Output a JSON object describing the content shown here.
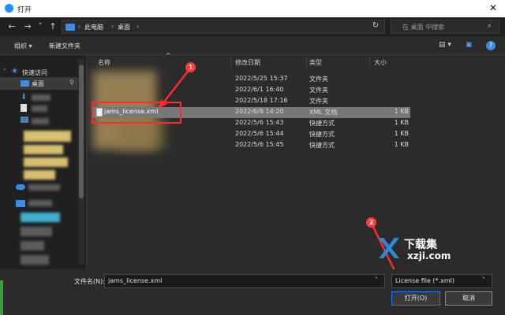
{
  "titlebar": {
    "title": "打开",
    "close": "✕"
  },
  "nav": {
    "back": "←",
    "forward": "→",
    "dropdown": "˅",
    "up": "↑",
    "crumbs": [
      "此电脑",
      "桌面"
    ],
    "separator": "›",
    "address_dropdown": "˅",
    "refresh": "↻",
    "search_placeholder": "在 桌面 中搜索",
    "search_icon": "⌕"
  },
  "toolbar": {
    "organize": "组织 ▾",
    "new_folder": "新建文件夹",
    "view": "▤ ▾",
    "preview": "▣",
    "help": "?"
  },
  "sidebar": {
    "quick_access": "快速访问",
    "desktop": "桌面"
  },
  "columns": {
    "name": "名称",
    "date": "修改日期",
    "type": "类型",
    "size": "大小",
    "sort_arrow": "^"
  },
  "files": [
    {
      "name": "",
      "date": "2022/5/25 15:37",
      "type": "文件夹",
      "size": ""
    },
    {
      "name": "",
      "date": "2022/6/1 16:40",
      "type": "文件夹",
      "size": ""
    },
    {
      "name": "",
      "date": "2022/5/18 17:16",
      "type": "文件夹",
      "size": ""
    },
    {
      "name": "jams_license.xml",
      "date": "2022/6/8 14:20",
      "type": "XML 文档",
      "size": "1 KB"
    },
    {
      "name": "",
      "date": "2022/5/6 15:43",
      "type": "快捷方式",
      "size": "1 KB"
    },
    {
      "name": "",
      "date": "2022/5/6 15:44",
      "type": "快捷方式",
      "size": "1 KB"
    },
    {
      "name": "",
      "date": "2022/5/6 15:45",
      "type": "快捷方式",
      "size": "1 KB"
    }
  ],
  "bottom": {
    "filename_label": "文件名(N):",
    "filename_value": "jams_license.xml",
    "filter_value": "License file (*.xml)",
    "open_button": "打开(O)",
    "cancel_button": "取消",
    "dropdown": "˅"
  },
  "annotations": {
    "badge1": "1",
    "badge2": "2"
  },
  "watermark": {
    "line1": "下载集",
    "line2": "xzji.com"
  },
  "colors": {
    "accent": "#1e78ff",
    "selection": "#777777",
    "annotation": "#ff2b2b",
    "watermark": "#2a8ad8"
  }
}
